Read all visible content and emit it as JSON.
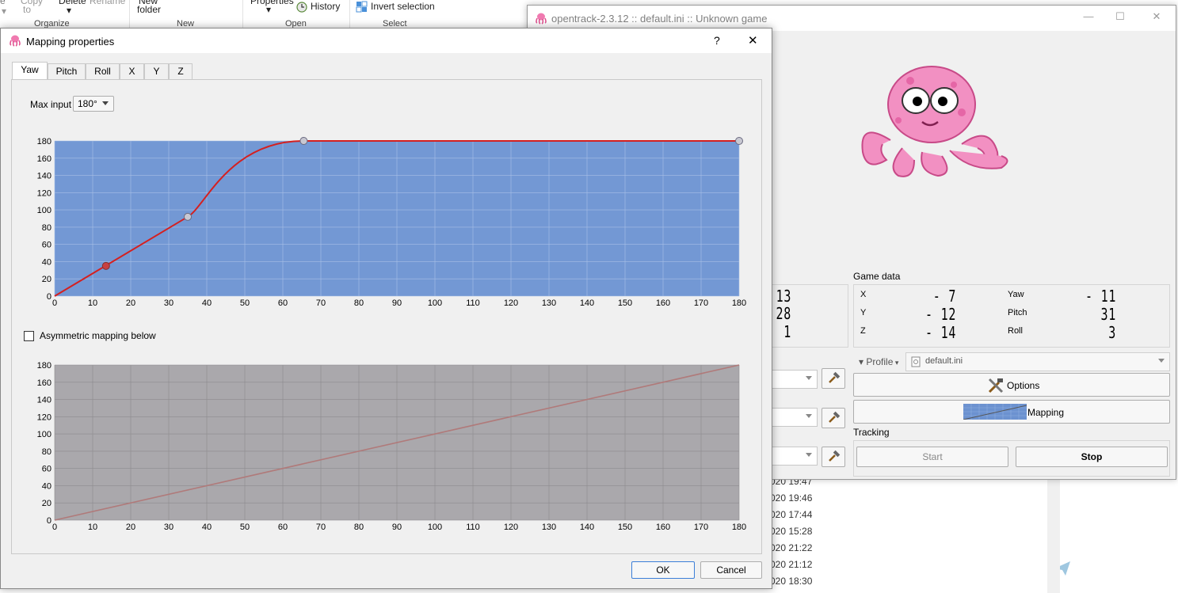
{
  "explorer": {
    "ribbon": {
      "copy_to_line1": "Copy",
      "copy_to_line2": "to",
      "delete": "Delete",
      "rename": "Rename",
      "new_folder_line1": "New",
      "new_folder_line2": "folder",
      "properties": "Properties",
      "history": "History",
      "invert_selection": "Invert selection",
      "groups": [
        "Organize",
        "New",
        "Open",
        "Select"
      ]
    },
    "modified_times": [
      "020 19:47",
      "020 19:46",
      "020 17:44",
      "020 15:28",
      "020 21:22",
      "020 21:12",
      "020 18:30"
    ]
  },
  "opentrack": {
    "title": "opentrack-2.3.12 :: default.ini :: Unknown game",
    "raw_values": [
      "- 13",
      "28",
      "1"
    ],
    "game_data": {
      "title": "Game data",
      "rows": [
        {
          "label": "X",
          "value": "- 7",
          "label2": "Yaw",
          "value2": "- 11"
        },
        {
          "label": "Y",
          "value": "- 12",
          "label2": "Pitch",
          "value2": "31"
        },
        {
          "label": "Z",
          "value": "- 14",
          "label2": "Roll",
          "value2": "3"
        }
      ]
    },
    "profile_label": "Profile",
    "profile_value": "default.ini",
    "options_label": "Options",
    "mapping_label": "Mapping",
    "tracking_title": "Tracking",
    "start_label": "Start",
    "stop_label": "Stop"
  },
  "mapping_dialog": {
    "title": "Mapping properties",
    "help": "?",
    "close": "✕",
    "tabs": [
      "Yaw",
      "Pitch",
      "Roll",
      "X",
      "Y",
      "Z"
    ],
    "active_tab": "Yaw",
    "max_input_label": "Max input",
    "max_input_value": "180°",
    "asymmetric_label": "Asymmetric mapping below",
    "ok_label": "OK",
    "cancel_label": "Cancel"
  },
  "chart_data": [
    {
      "type": "line",
      "x_ticks": [
        0,
        10,
        20,
        30,
        40,
        50,
        60,
        70,
        80,
        90,
        100,
        110,
        120,
        130,
        140,
        150,
        160,
        170,
        180
      ],
      "y_ticks": [
        0,
        20,
        40,
        60,
        80,
        100,
        120,
        140,
        160,
        180
      ],
      "xlim": [
        0,
        180
      ],
      "ylim": [
        0,
        180
      ],
      "grid": true,
      "background": "#7398d4",
      "line_color": "#d42020",
      "control_points": [
        [
          0,
          0
        ],
        [
          35,
          92
        ],
        [
          65.5,
          180
        ],
        [
          180,
          180
        ]
      ],
      "live_point": [
        13.5,
        35
      ]
    },
    {
      "type": "line",
      "x_ticks": [
        0,
        10,
        20,
        30,
        40,
        50,
        60,
        70,
        80,
        90,
        100,
        110,
        120,
        130,
        140,
        150,
        160,
        170,
        180
      ],
      "y_ticks": [
        0,
        20,
        40,
        60,
        80,
        100,
        120,
        140,
        160,
        180
      ],
      "xlim": [
        0,
        180
      ],
      "ylim": [
        0,
        180
      ],
      "grid": true,
      "background": "#aaa8ac",
      "line_color": "#b07a7a",
      "control_points": [
        [
          0,
          0
        ],
        [
          180,
          180
        ]
      ]
    }
  ]
}
